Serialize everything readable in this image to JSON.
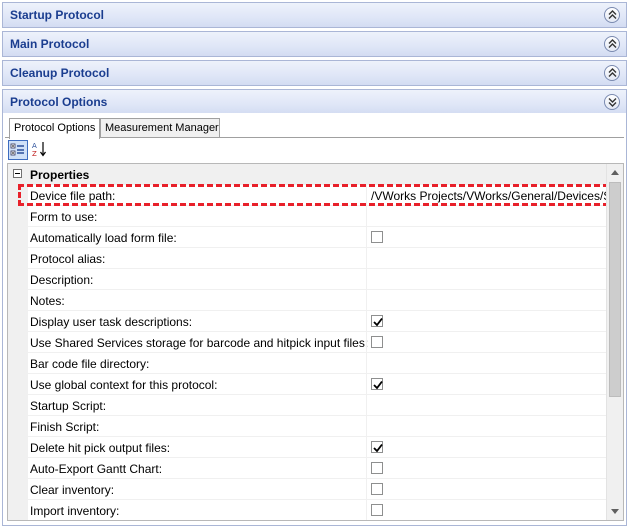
{
  "sections": [
    {
      "title": "Startup Protocol",
      "state": "collapsed"
    },
    {
      "title": "Main Protocol",
      "state": "collapsed"
    },
    {
      "title": "Cleanup Protocol",
      "state": "collapsed"
    },
    {
      "title": "Protocol Options",
      "state": "expanded"
    }
  ],
  "tabs": [
    {
      "label": "Protocol Options",
      "active": true
    },
    {
      "label": "Measurement Manager",
      "active": false
    }
  ],
  "toolbar": {
    "categorized_icon": "categorized-view-icon",
    "alphabetical_icon": "sort-alphabetical-icon"
  },
  "property_grid": {
    "category": "Properties",
    "rows": [
      {
        "name": "Device file path:",
        "type": "text",
        "value": "/VWorks Projects/VWorks/General/Devices/S"
      },
      {
        "name": "Form to use:",
        "type": "text",
        "value": ""
      },
      {
        "name": "Automatically load form file:",
        "type": "checkbox",
        "checked": false
      },
      {
        "name": "Protocol alias:",
        "type": "text",
        "value": ""
      },
      {
        "name": "Description:",
        "type": "text",
        "value": ""
      },
      {
        "name": "Notes:",
        "type": "text",
        "value": ""
      },
      {
        "name": "Display user task descriptions:",
        "type": "checkbox",
        "checked": true
      },
      {
        "name": "Use Shared Services storage for barcode and hitpick input files:",
        "type": "checkbox",
        "checked": false
      },
      {
        "name": "Bar code file directory:",
        "type": "text",
        "value": ""
      },
      {
        "name": "Use global context for this protocol:",
        "type": "checkbox",
        "checked": true
      },
      {
        "name": "Startup Script:",
        "type": "text",
        "value": ""
      },
      {
        "name": "Finish Script:",
        "type": "text",
        "value": ""
      },
      {
        "name": "Delete hit pick output files:",
        "type": "checkbox",
        "checked": true
      },
      {
        "name": "Auto-Export Gantt Chart:",
        "type": "checkbox",
        "checked": false
      },
      {
        "name": "Clear inventory:",
        "type": "checkbox",
        "checked": false
      },
      {
        "name": "Import inventory:",
        "type": "checkbox",
        "checked": false
      }
    ]
  },
  "colors": {
    "section_title": "#1a3d8f",
    "highlight": "#e8202a"
  }
}
